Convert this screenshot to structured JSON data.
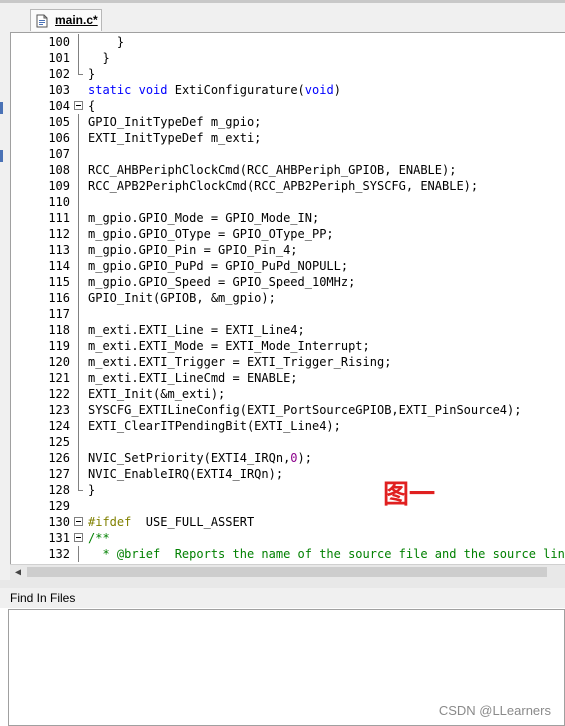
{
  "tab": {
    "label": "main.c*"
  },
  "annotation": "图一",
  "panel": {
    "title": "Find In Files"
  },
  "watermark": "CSDN @LLearners",
  "colors": {
    "keyword": "#0000ff",
    "number": "#8b008b",
    "preprocessor": "#808000",
    "comment": "#008000",
    "annotation": "#e02020"
  },
  "lines": [
    {
      "n": "100",
      "fold": "v",
      "parts": [
        [
          "",
          "    }"
        ]
      ]
    },
    {
      "n": "101",
      "fold": "v",
      "parts": [
        [
          "",
          "  }"
        ]
      ]
    },
    {
      "n": "102",
      "fold": "end",
      "parts": [
        [
          "",
          "}"
        ]
      ]
    },
    {
      "n": "103",
      "fold": "",
      "parts": [
        [
          "kw",
          "static"
        ],
        [
          "",
          " "
        ],
        [
          "kw",
          "void"
        ],
        [
          "",
          " ExtiConfigurature("
        ],
        [
          "kw",
          "void"
        ],
        [
          "",
          ")"
        ]
      ]
    },
    {
      "n": "104",
      "fold": "box",
      "parts": [
        [
          "",
          "{"
        ]
      ]
    },
    {
      "n": "105",
      "fold": "v",
      "parts": [
        [
          "",
          "GPIO_InitTypeDef m_gpio;"
        ]
      ]
    },
    {
      "n": "106",
      "fold": "v",
      "parts": [
        [
          "",
          "EXTI_InitTypeDef m_exti;"
        ]
      ]
    },
    {
      "n": "107",
      "fold": "v",
      "parts": [
        [
          "",
          ""
        ]
      ]
    },
    {
      "n": "108",
      "fold": "v",
      "parts": [
        [
          "",
          "RCC_AHBPeriphClockCmd(RCC_AHBPeriph_GPIOB, ENABLE);"
        ]
      ]
    },
    {
      "n": "109",
      "fold": "v",
      "parts": [
        [
          "",
          "RCC_APB2PeriphClockCmd(RCC_APB2Periph_SYSCFG, ENABLE);"
        ]
      ]
    },
    {
      "n": "110",
      "fold": "v",
      "parts": [
        [
          "",
          ""
        ]
      ]
    },
    {
      "n": "111",
      "fold": "v",
      "parts": [
        [
          "",
          "m_gpio.GPIO_Mode = GPIO_Mode_IN;"
        ]
      ]
    },
    {
      "n": "112",
      "fold": "v",
      "parts": [
        [
          "",
          "m_gpio.GPIO_OType = GPIO_OType_PP;"
        ]
      ]
    },
    {
      "n": "113",
      "fold": "v",
      "parts": [
        [
          "",
          "m_gpio.GPIO_Pin = GPIO_Pin_4;"
        ]
      ]
    },
    {
      "n": "114",
      "fold": "v",
      "parts": [
        [
          "",
          "m_gpio.GPIO_PuPd = GPIO_PuPd_NOPULL;"
        ]
      ]
    },
    {
      "n": "115",
      "fold": "v",
      "parts": [
        [
          "",
          "m_gpio.GPIO_Speed = GPIO_Speed_10MHz;"
        ]
      ]
    },
    {
      "n": "116",
      "fold": "v",
      "parts": [
        [
          "",
          "GPIO_Init(GPIOB, &m_gpio);"
        ]
      ]
    },
    {
      "n": "117",
      "fold": "v",
      "parts": [
        [
          "",
          ""
        ]
      ]
    },
    {
      "n": "118",
      "fold": "v",
      "parts": [
        [
          "",
          "m_exti.EXTI_Line = EXTI_Line4;"
        ]
      ]
    },
    {
      "n": "119",
      "fold": "v",
      "parts": [
        [
          "",
          "m_exti.EXTI_Mode = EXTI_Mode_Interrupt;"
        ]
      ]
    },
    {
      "n": "120",
      "fold": "v",
      "parts": [
        [
          "",
          "m_exti.EXTI_Trigger = EXTI_Trigger_Rising;"
        ]
      ]
    },
    {
      "n": "121",
      "fold": "v",
      "parts": [
        [
          "",
          "m_exti.EXTI_LineCmd = ENABLE;"
        ]
      ]
    },
    {
      "n": "122",
      "fold": "v",
      "parts": [
        [
          "",
          "EXTI_Init(&m_exti);"
        ]
      ]
    },
    {
      "n": "123",
      "fold": "v",
      "parts": [
        [
          "",
          "SYSCFG_EXTILineConfig(EXTI_PortSourceGPIOB,EXTI_PinSource4);"
        ]
      ]
    },
    {
      "n": "124",
      "fold": "v",
      "parts": [
        [
          "",
          "EXTI_ClearITPendingBit(EXTI_Line4);"
        ]
      ]
    },
    {
      "n": "125",
      "fold": "v",
      "parts": [
        [
          "",
          ""
        ]
      ]
    },
    {
      "n": "126",
      "fold": "v",
      "parts": [
        [
          "",
          "NVIC_SetPriority(EXTI4_IRQn,"
        ],
        [
          "num",
          "0"
        ],
        [
          "",
          ");"
        ]
      ]
    },
    {
      "n": "127",
      "fold": "v",
      "parts": [
        [
          "",
          "NVIC_EnableIRQ(EXTI4_IRQn);"
        ]
      ]
    },
    {
      "n": "128",
      "fold": "end",
      "parts": [
        [
          "",
          "}"
        ]
      ]
    },
    {
      "n": "129",
      "fold": "",
      "parts": [
        [
          "",
          ""
        ]
      ]
    },
    {
      "n": "130",
      "fold": "box",
      "parts": [
        [
          "pp",
          "#ifdef"
        ],
        [
          "",
          "  USE_FULL_ASSERT"
        ]
      ]
    },
    {
      "n": "131",
      "fold": "box",
      "parts": [
        [
          "cm",
          "/**"
        ]
      ]
    },
    {
      "n": "132",
      "fold": "v",
      "parts": [
        [
          "cm",
          "  * @brief  Reports the name of the source file and the source line number"
        ]
      ]
    }
  ]
}
